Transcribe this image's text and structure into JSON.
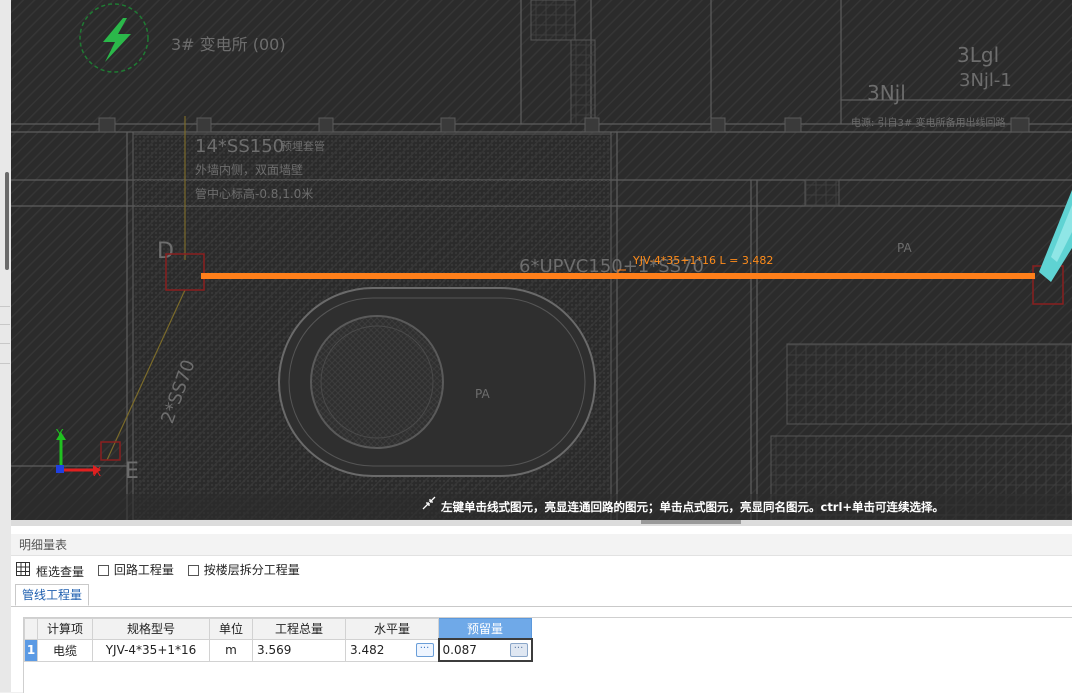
{
  "canvas": {
    "pipe_label": "YJV-4*35+1*16 L = 3.482",
    "cad_texts": {
      "equip_title": "3# 变电所 (00)",
      "ss150": "14*SS150",
      "ss150_note": "预埋套管",
      "note_1": "外墙内侧，双面墙壁",
      "note_2": "管中心标高-0.8,1.0米",
      "upvc": "6*UPVC150+1*SS70",
      "ss70": "2*SS70",
      "letter_d": "D",
      "letter_e": "E",
      "pa_1": "PA",
      "pa_2": "PA",
      "lgl": "3Lgl",
      "nj1_a": "3Njl-1",
      "nj1_b": "3Njl",
      "power_note": "电源: 引自3# 变电所备用出线回路"
    },
    "axis": {
      "x": "X",
      "y": "Y"
    },
    "hint": "左键单击线式图元，亮显连通回路的图元；单击点式图元，亮显同名图元。ctrl+单击可连续选择。"
  },
  "panel": {
    "title": "明细量表",
    "toolbar": {
      "box_select": "框选查量",
      "loop_qty": "回路工程量",
      "floor_split": "按楼层拆分工程量"
    },
    "tabs": [
      {
        "label": "管线工程量"
      }
    ],
    "table": {
      "headers": [
        "计算项",
        "规格型号",
        "单位",
        "工程总量",
        "水平量",
        "预留量"
      ],
      "rows": [
        {
          "index": "1",
          "item": "电缆",
          "spec": "YJV-4*35+1*16",
          "unit": "m",
          "total": "3.569",
          "horizontal": "3.482",
          "reserve": "0.087"
        }
      ]
    }
  },
  "colors": {
    "canvas_bg": "#2b2b2b",
    "pipe": "#ff7f1a",
    "highlight_header": "#6fa9e8",
    "tab_text": "#2060b0",
    "cyan_segment": "#5fd3d3",
    "lightning": "#2bb84a"
  },
  "icons": {
    "select": "select-arrows-icon",
    "grid": "grid-icon",
    "lightning": "lightning-icon",
    "more": "ellipsis-icon"
  }
}
